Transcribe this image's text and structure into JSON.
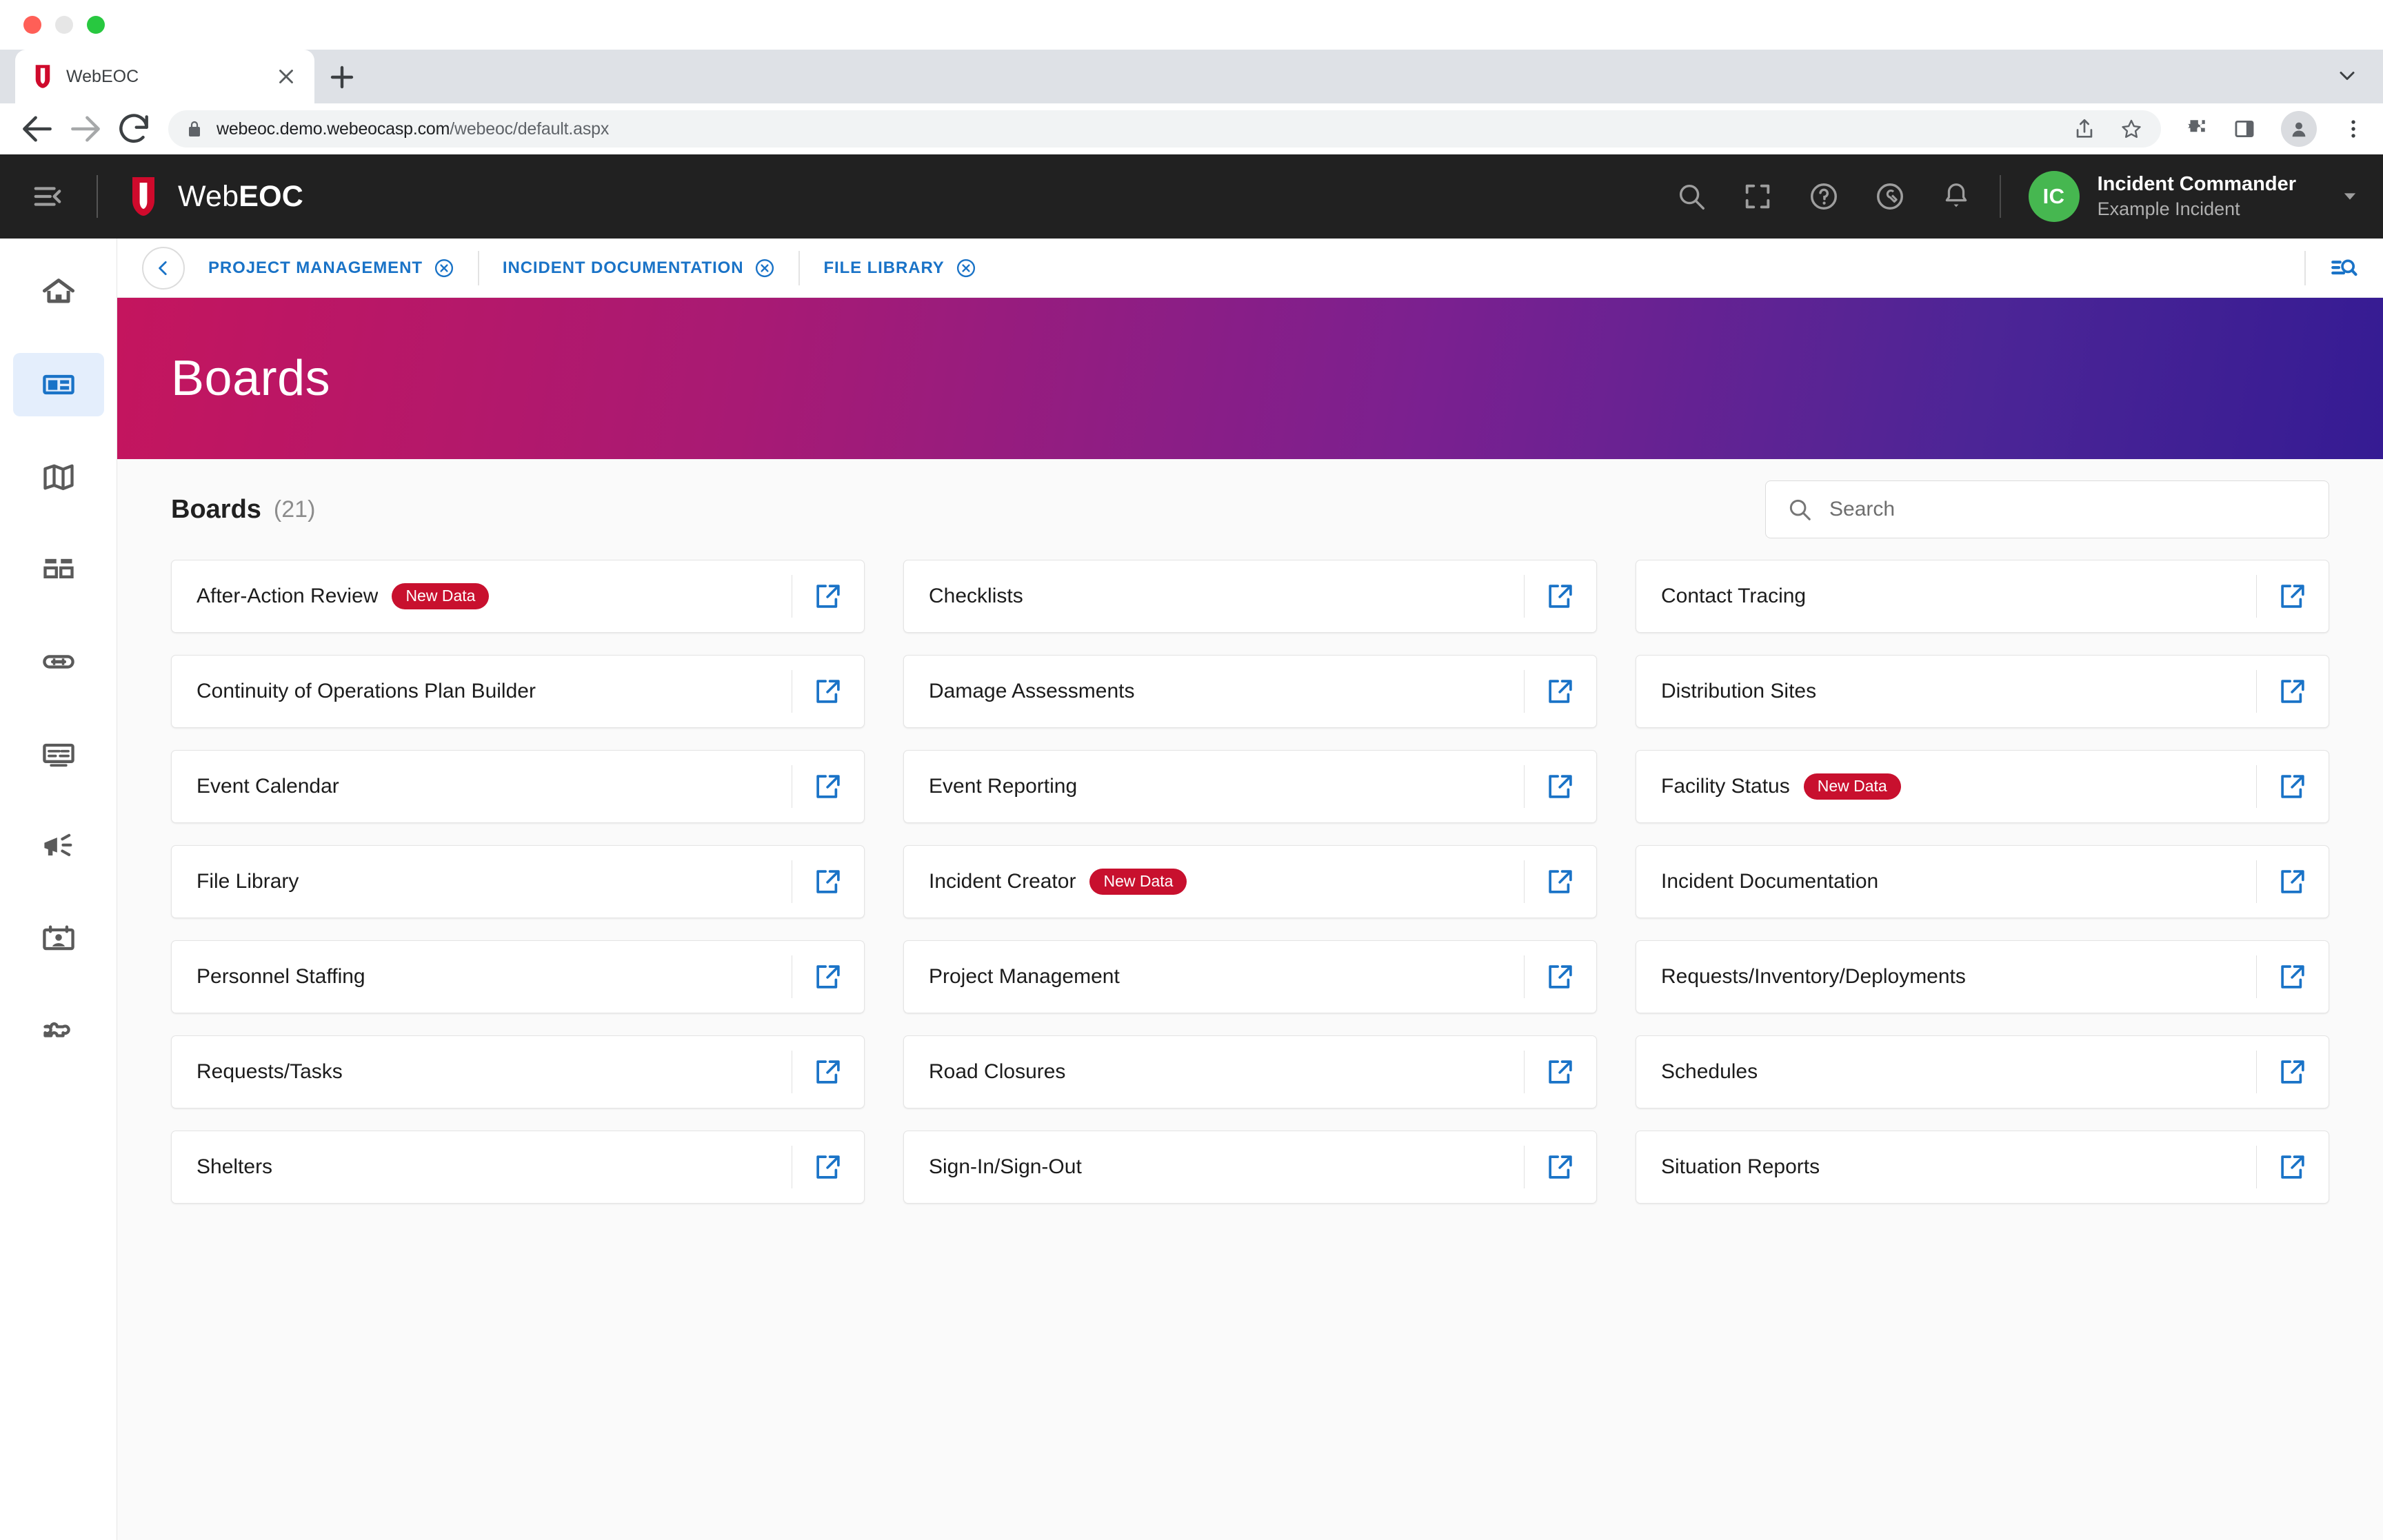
{
  "browser": {
    "tab": {
      "title": "WebEOC",
      "favicon_icon": "webeoc-shield-favicon",
      "close_icon": "close-icon"
    },
    "new_tab_icon": "plus-icon",
    "tablist_chevron_icon": "chevron-down-icon",
    "back_icon": "back-arrow-icon",
    "forward_icon": "forward-arrow-icon",
    "reload_icon": "reload-icon",
    "lock_icon": "lock-icon",
    "url_host": "webeoc.demo.webeocasp.com",
    "url_path": "/webeoc/default.aspx",
    "share_icon": "share-icon",
    "bookmark_icon": "star-icon",
    "extensions_icon": "puzzle-icon",
    "side_panel_icon": "side-panel-icon",
    "profile_icon": "profile-avatar-icon",
    "menu_icon": "three-dot-menu-icon"
  },
  "appbar": {
    "menu_toggle_icon": "hamburger-collapse-icon",
    "brand_logo_icon": "webeoc-shield-logo",
    "brand_prefix": "Web",
    "brand_suffix": "EOC",
    "icons": [
      {
        "name": "search-icon",
        "label": "Search"
      },
      {
        "name": "fullscreen-icon",
        "label": "Full Screen"
      },
      {
        "name": "help-icon",
        "label": "Help"
      },
      {
        "name": "tools-icon",
        "label": "Tools"
      },
      {
        "name": "notifications-bell-icon",
        "label": "Notifications"
      }
    ],
    "user": {
      "initials": "IC",
      "name": "Incident Commander",
      "incident": "Example Incident",
      "caret_icon": "caret-down-icon",
      "avatar_color": "#46b750"
    }
  },
  "rail": {
    "items": [
      {
        "name": "home",
        "icon": "home-icon",
        "active": false
      },
      {
        "name": "boards",
        "icon": "boards-panel-icon",
        "active": true
      },
      {
        "name": "maps",
        "icon": "map-icon",
        "active": false
      },
      {
        "name": "dashboards",
        "icon": "dashboard-grid-icon",
        "active": false
      },
      {
        "name": "links",
        "icon": "link-chain-icon",
        "active": false
      },
      {
        "name": "displays",
        "icon": "monitor-display-icon",
        "active": false
      },
      {
        "name": "announcements",
        "icon": "megaphone-icon",
        "active": false
      },
      {
        "name": "contacts",
        "icon": "contact-card-icon",
        "active": false
      },
      {
        "name": "plugins",
        "icon": "puzzle-piece-icon",
        "active": false
      }
    ],
    "active_color": "#1a73c7",
    "active_bg": "#e4eefc"
  },
  "tabbar": {
    "back_icon": "chevron-left-icon",
    "crumbs": [
      {
        "label": "PROJECT MANAGEMENT",
        "close_icon": "close-circle-icon"
      },
      {
        "label": "INCIDENT DOCUMENTATION",
        "close_icon": "close-circle-icon"
      },
      {
        "label": "FILE LIBRARY",
        "close_icon": "close-circle-icon"
      }
    ],
    "list_search_icon": "list-search-icon",
    "link_color": "#1a73c7"
  },
  "banner": {
    "title": "Boards",
    "gradient_from": "#c4155e",
    "gradient_to": "#351b93"
  },
  "panel": {
    "title": "Boards",
    "count": "(21)",
    "search": {
      "placeholder": "Search",
      "value": "",
      "icon": "search-icon"
    },
    "badge_color": "#c8102e",
    "open_icon_color": "#1a73c7",
    "cards": [
      {
        "label": "After-Action Review",
        "badge": "New Data",
        "open_icon": "open-in-new-icon"
      },
      {
        "label": "Checklists",
        "badge": null,
        "open_icon": "open-in-new-icon"
      },
      {
        "label": "Contact Tracing",
        "badge": null,
        "open_icon": "open-in-new-icon"
      },
      {
        "label": "Continuity of Operations Plan Builder",
        "badge": null,
        "open_icon": "open-in-new-icon"
      },
      {
        "label": "Damage Assessments",
        "badge": null,
        "open_icon": "open-in-new-icon"
      },
      {
        "label": "Distribution Sites",
        "badge": null,
        "open_icon": "open-in-new-icon"
      },
      {
        "label": "Event Calendar",
        "badge": null,
        "open_icon": "open-in-new-icon"
      },
      {
        "label": "Event Reporting",
        "badge": null,
        "open_icon": "open-in-new-icon"
      },
      {
        "label": "Facility Status",
        "badge": "New Data",
        "open_icon": "open-in-new-icon"
      },
      {
        "label": "File Library",
        "badge": null,
        "open_icon": "open-in-new-icon"
      },
      {
        "label": "Incident Creator",
        "badge": "New Data",
        "open_icon": "open-in-new-icon"
      },
      {
        "label": "Incident Documentation",
        "badge": null,
        "open_icon": "open-in-new-icon"
      },
      {
        "label": "Personnel Staffing",
        "badge": null,
        "open_icon": "open-in-new-icon"
      },
      {
        "label": "Project Management",
        "badge": null,
        "open_icon": "open-in-new-icon"
      },
      {
        "label": "Requests/Inventory/Deployments",
        "badge": null,
        "open_icon": "open-in-new-icon"
      },
      {
        "label": "Requests/Tasks",
        "badge": null,
        "open_icon": "open-in-new-icon"
      },
      {
        "label": "Road Closures",
        "badge": null,
        "open_icon": "open-in-new-icon"
      },
      {
        "label": "Schedules",
        "badge": null,
        "open_icon": "open-in-new-icon"
      },
      {
        "label": "Shelters",
        "badge": null,
        "open_icon": "open-in-new-icon"
      },
      {
        "label": "Sign-In/Sign-Out",
        "badge": null,
        "open_icon": "open-in-new-icon"
      },
      {
        "label": "Situation Reports",
        "badge": null,
        "open_icon": "open-in-new-icon"
      }
    ]
  }
}
